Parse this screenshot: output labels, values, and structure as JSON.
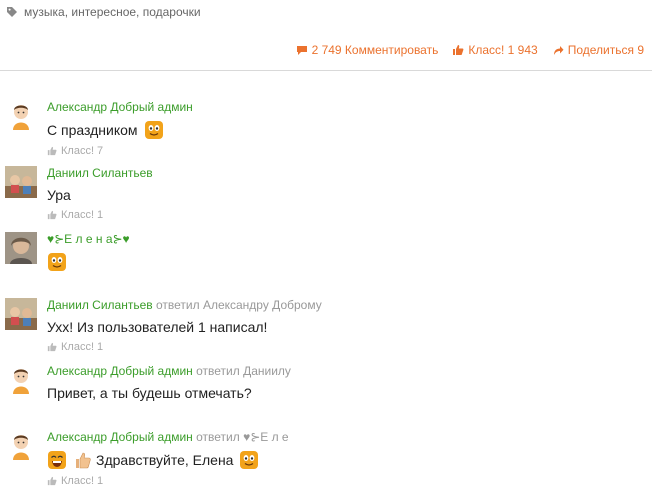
{
  "tags": {
    "text": "музыка, интересное, подарочки"
  },
  "actions": {
    "comments": "2 749 Комментировать",
    "class": "Класс! 1 943",
    "share": "Поделиться 9"
  },
  "comments": [
    {
      "author": "Александр Добрый админ",
      "replied": "",
      "text": "С праздником",
      "like": "Класс! 7"
    },
    {
      "author": "Даниил Силантьев",
      "replied": "",
      "text": "Ура",
      "like": "Класс! 1"
    },
    {
      "author": "♥⊱Е л е н а⊱♥",
      "replied": "",
      "text": "",
      "like": ""
    },
    {
      "author": "Даниил Силантьев",
      "replied": "ответил Александру Доброму",
      "text": "Ухх! Из пользователей 1 написал!",
      "like": "Класс! 1"
    },
    {
      "author": "Александр Добрый админ",
      "replied": "ответил Даниилу",
      "text": "Привет, а ты будешь отмечать?",
      "like": ""
    },
    {
      "author": "Александр Добрый админ",
      "replied": "ответил ♥⊱Е л е",
      "text": "Здравствуйте, Елена",
      "like": "Класс! 1"
    }
  ],
  "colors": {
    "accent": "#eb722e",
    "author": "#3b9d2a",
    "muted": "#999999"
  }
}
